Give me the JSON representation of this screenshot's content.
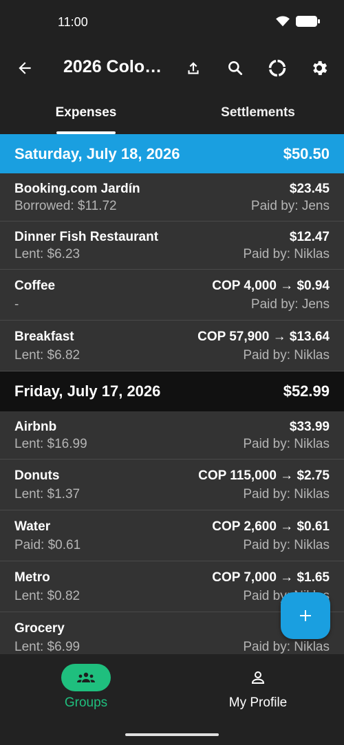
{
  "status_bar": {
    "time": "11:00"
  },
  "app_bar": {
    "title": "2026 Colo…"
  },
  "tabs": [
    {
      "label": "Expenses",
      "active": true
    },
    {
      "label": "Settlements",
      "active": false
    }
  ],
  "days": [
    {
      "date": "Saturday, July 18, 2026",
      "total": "$50.50",
      "expenses": [
        {
          "name": "Booking.com Jardín",
          "share": "Borrowed: $11.72",
          "amount": "$23.45",
          "payer": "Paid by: Jens"
        },
        {
          "name": "Dinner Fish Restaurant",
          "share": "Lent: $6.23",
          "amount": "$12.47",
          "payer": "Paid by: Niklas"
        },
        {
          "name": "Coffee",
          "share": "-",
          "amount": "COP 4,000 → $0.94",
          "payer": "Paid by: Jens"
        },
        {
          "name": "Breakfast",
          "share": "Lent: $6.82",
          "amount": "COP 57,900 → $13.64",
          "payer": "Paid by: Niklas"
        }
      ]
    },
    {
      "date": "Friday, July 17, 2026",
      "total": "$52.99",
      "expenses": [
        {
          "name": "Airbnb",
          "share": "Lent: $16.99",
          "amount": "$33.99",
          "payer": "Paid by: Niklas"
        },
        {
          "name": "Donuts",
          "share": "Lent: $1.37",
          "amount": "COP 115,000 → $2.75",
          "payer": "Paid by: Niklas"
        },
        {
          "name": "Water",
          "share": "Paid: $0.61",
          "amount": "COP 2,600 → $0.61",
          "payer": "Paid by: Niklas"
        },
        {
          "name": "Metro",
          "share": "Lent: $0.82",
          "amount": "COP 7,000 → $1.65",
          "payer": "Paid by: Niklas"
        },
        {
          "name": "Grocery",
          "share": "Lent: $6.99",
          "amount": "",
          "payer": "Paid by: Niklas"
        }
      ]
    }
  ],
  "bottom_nav": [
    {
      "label": "Groups",
      "icon": "groups-icon",
      "active": true
    },
    {
      "label": "My Profile",
      "icon": "person-icon",
      "active": false
    }
  ],
  "colors": {
    "accent_blue": "#1a9fe0",
    "accent_green": "#1fbf7e",
    "background": "#212121",
    "row": "#333333"
  }
}
